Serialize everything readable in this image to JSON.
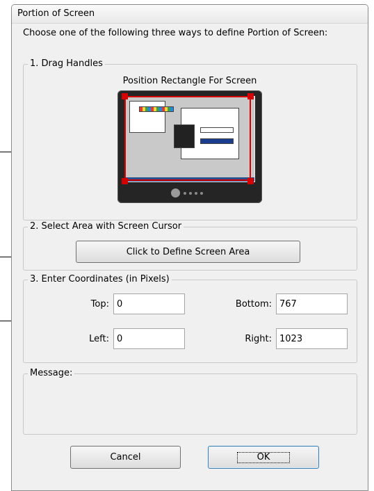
{
  "window": {
    "title": "Portion of Screen"
  },
  "intro_text": "Choose one of the following three ways to define Portion of Screen:",
  "section_drag": {
    "legend": "1. Drag Handles",
    "caption": "Position Rectangle For Screen"
  },
  "section_select": {
    "legend": "2. Select Area with Screen Cursor",
    "button_label": "Click to Define Screen Area"
  },
  "section_coords": {
    "legend": "3. Enter Coordinates (in Pixels)",
    "top_label": "Top:",
    "top_value": "0",
    "bottom_label": "Bottom:",
    "bottom_value": "767",
    "left_label": "Left:",
    "left_value": "0",
    "right_label": "Right:",
    "right_value": "1023"
  },
  "section_message": {
    "legend": "Message:",
    "text": ""
  },
  "buttons": {
    "cancel": "Cancel",
    "ok": "OK"
  },
  "colors": {
    "selection_rect": "#d50000",
    "dialog_bg": "#f0f0f0",
    "monitor_bezel": "#252525"
  }
}
